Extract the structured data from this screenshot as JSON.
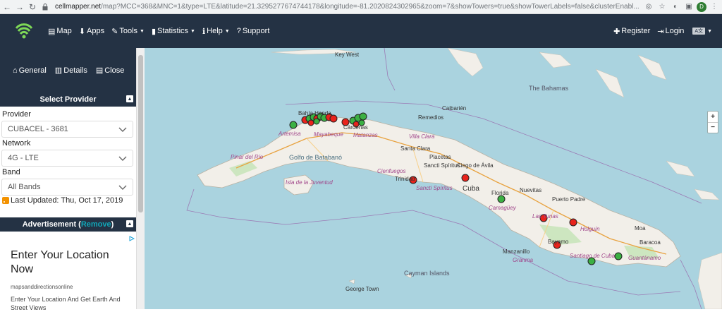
{
  "browser": {
    "url_host": "cellmapper.net",
    "url_rest": "/map?MCC=368&MNC=1&type=LTE&latitude=21.3295277674744178&longitude=-81.2020824302965&zoom=7&showTowers=true&showTowerLabels=false&clusterEnabl...",
    "profile_initial": "D"
  },
  "nav": {
    "items": [
      {
        "label": "Map",
        "icon": "map-icon"
      },
      {
        "label": "Apps",
        "icon": "download-icon"
      },
      {
        "label": "Tools",
        "icon": "wrench-icon",
        "dropdown": true
      },
      {
        "label": "Statistics",
        "icon": "bar-chart-icon",
        "dropdown": true
      },
      {
        "label": "Help",
        "icon": "info-icon",
        "dropdown": true
      },
      {
        "label": "Support",
        "icon": "question-icon"
      }
    ],
    "register": "Register",
    "login": "Login",
    "lang_badge": "A文"
  },
  "sidebar": {
    "general": "General",
    "details": "Details",
    "close": "Close",
    "select_provider_title": "Select Provider",
    "provider_label": "Provider",
    "provider_value": "CUBACEL - 3681",
    "network_label": "Network",
    "network_value": "4G - LTE",
    "band_label": "Band",
    "band_value": "All Bands",
    "last_updated": "Last Updated: Thu, Oct 17, 2019",
    "ad_title_prefix": "Advertisement (",
    "ad_remove": "Remove",
    "ad_title_suffix": ")"
  },
  "ad": {
    "headline": "Enter Your Location Now",
    "domain": "mapsanddirectionsonline",
    "description": "Enter Your Location And Get Earth And Street Views"
  },
  "map": {
    "zoom_in": "+",
    "zoom_out": "−",
    "labels": {
      "key_west": "Key West",
      "bahamas": "The Bahamas",
      "caibarien": "Caibarién",
      "remedios": "Remedios",
      "villa_clara": "Villa Clara",
      "santa_clara": "Santa Clara",
      "placetas": "Placetas",
      "sancti_spiritus_city": "Sancti Spíritus",
      "ciego_de_avila": "Ciego de Ávila",
      "cienfuegos": "Cienfuegos",
      "trinidad": "Trinidad",
      "sancti_spiritus_prov": "Sancti Spíritus",
      "cuba": "Cuba",
      "florida": "Florida",
      "camaguey": "Camagüey",
      "nuevitas": "Nuevitas",
      "puerto_padre": "Puerto Padre",
      "las_tunas": "Las Tunas",
      "holguin": "Holguín",
      "moa": "Moa",
      "baracoa": "Baracoa",
      "bayamo": "Bayamo",
      "manzanillo": "Manzanillo",
      "granma": "Granma",
      "santiago": "Santiago de Cuba",
      "guantanamo": "Guantánamo",
      "artemisa": "Artemisa",
      "mayabeque": "Mayabeque",
      "matanzas": "Matanzas",
      "pinar": "Pinar del Río",
      "golfo_batabano": "Golfo de Batabanó",
      "isla_juventud": "Isla de la Juventud",
      "cayman_islands": "Cayman Islands",
      "george_town": "George Town",
      "bahia_honda": "Bahía Honda",
      "cardenas": "Cárdenas"
    },
    "towers": [
      {
        "status": "active",
        "color": "#3cb043"
      },
      {
        "status": "inactive",
        "color": "#e8231c"
      }
    ]
  }
}
